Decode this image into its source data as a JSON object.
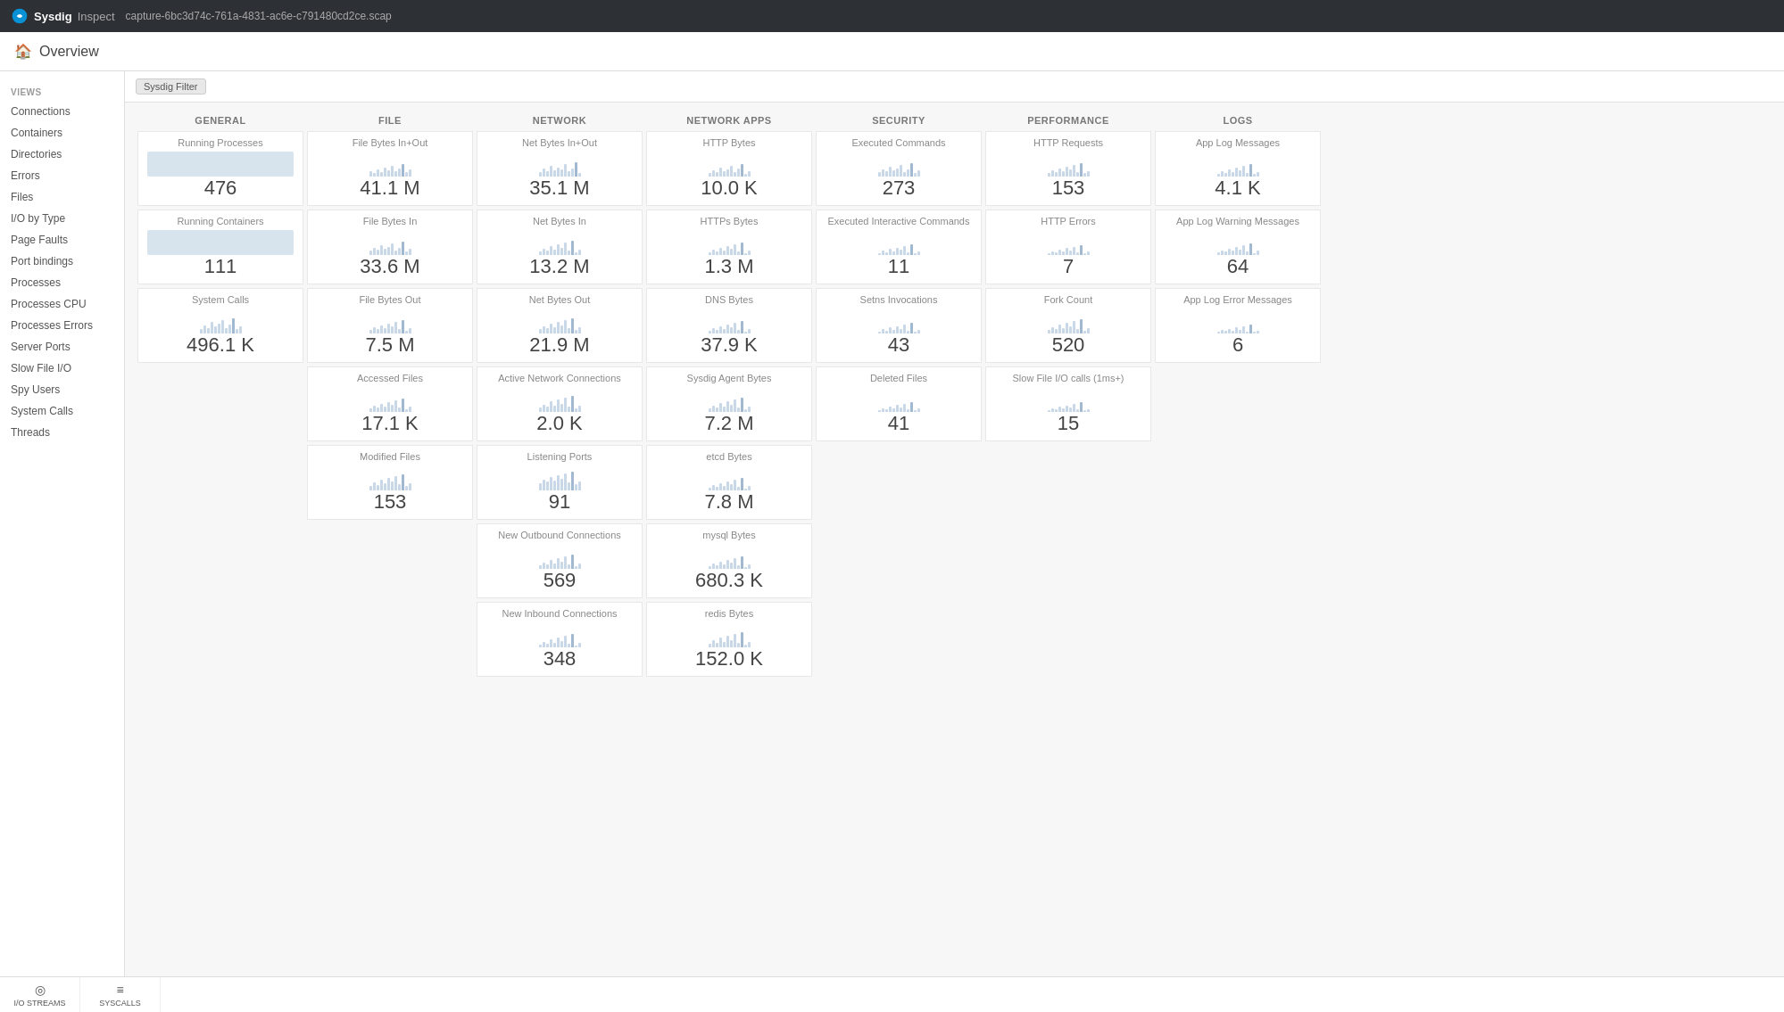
{
  "topbar": {
    "brand": "Sysdig",
    "product": "Inspect",
    "filename": "capture-6bc3d74c-761a-4831-ac6e-c791480cd2ce.scap"
  },
  "subheader": {
    "title": "Overview"
  },
  "filter_label": "Sysdig Filter",
  "sidebar": {
    "section": "VIEWS",
    "items": [
      "Connections",
      "Containers",
      "Directories",
      "Errors",
      "Files",
      "I/O by Type",
      "Page Faults",
      "Port bindings",
      "Processes",
      "Processes CPU",
      "Processes Errors",
      "Server Ports",
      "Slow File I/O",
      "Spy Users",
      "System Calls",
      "Threads"
    ]
  },
  "grid": {
    "columns": [
      "GENERAL",
      "FILE",
      "NETWORK",
      "NETWORK APPS",
      "SECURITY",
      "PERFORMANCE",
      "LOGS"
    ],
    "rows": [
      [
        {
          "label": "Running Processes",
          "value": "476",
          "type": "bg"
        },
        {
          "label": "File Bytes In+Out",
          "value": "41.1 M",
          "type": "bar"
        },
        {
          "label": "Net Bytes In+Out",
          "value": "35.1 M",
          "type": "bar"
        },
        {
          "label": "HTTP Bytes",
          "value": "10.0 K",
          "type": "bar"
        },
        {
          "label": "Executed Commands",
          "value": "273",
          "type": "bar"
        },
        {
          "label": "HTTP Requests",
          "value": "153",
          "type": "bar"
        },
        {
          "label": "App Log Messages",
          "value": "4.1 K",
          "type": "bar"
        }
      ],
      [
        {
          "label": "Running Containers",
          "value": "111",
          "type": "bg"
        },
        {
          "label": "File Bytes In",
          "value": "33.6 M",
          "type": "bar"
        },
        {
          "label": "Net Bytes In",
          "value": "13.2 M",
          "type": "bar"
        },
        {
          "label": "HTTPs Bytes",
          "value": "1.3 M",
          "type": "bar"
        },
        {
          "label": "Executed Interactive Commands",
          "value": "11",
          "type": "bar"
        },
        {
          "label": "HTTP Errors",
          "value": "7",
          "type": "bar"
        },
        {
          "label": "App Log Warning Messages",
          "value": "64",
          "type": "bar"
        }
      ],
      [
        {
          "label": "System Calls",
          "value": "496.1 K",
          "type": "bar"
        },
        {
          "label": "File Bytes Out",
          "value": "7.5 M",
          "type": "bar"
        },
        {
          "label": "Net Bytes Out",
          "value": "21.9 M",
          "type": "bar"
        },
        {
          "label": "DNS Bytes",
          "value": "37.9 K",
          "type": "bar"
        },
        {
          "label": "Setns Invocations",
          "value": "43",
          "type": "bar"
        },
        {
          "label": "Fork Count",
          "value": "520",
          "type": "bar"
        },
        {
          "label": "App Log Error Messages",
          "value": "6",
          "type": "bar"
        }
      ],
      [
        {
          "label": "",
          "value": "",
          "type": "empty"
        },
        {
          "label": "Accessed Files",
          "value": "17.1 K",
          "type": "bar"
        },
        {
          "label": "Active Network Connections",
          "value": "2.0 K",
          "type": "bar"
        },
        {
          "label": "Sysdig Agent Bytes",
          "value": "7.2 M",
          "type": "bar"
        },
        {
          "label": "Deleted Files",
          "value": "41",
          "type": "bar"
        },
        {
          "label": "Slow File I/O calls (1ms+)",
          "value": "15",
          "type": "bar"
        },
        {
          "label": "",
          "value": "",
          "type": "empty"
        }
      ],
      [
        {
          "label": "",
          "value": "",
          "type": "empty"
        },
        {
          "label": "Modified Files",
          "value": "153",
          "type": "bar"
        },
        {
          "label": "Listening Ports",
          "value": "91",
          "type": "bar"
        },
        {
          "label": "etcd Bytes",
          "value": "7.8 M",
          "type": "bar"
        },
        {
          "label": "",
          "value": "",
          "type": "empty"
        },
        {
          "label": "",
          "value": "",
          "type": "empty"
        },
        {
          "label": "",
          "value": "",
          "type": "empty"
        }
      ],
      [
        {
          "label": "",
          "value": "",
          "type": "empty"
        },
        {
          "label": "",
          "value": "",
          "type": "empty"
        },
        {
          "label": "New Outbound Connections",
          "value": "569",
          "type": "bar"
        },
        {
          "label": "mysql Bytes",
          "value": "680.3 K",
          "type": "bar"
        },
        {
          "label": "",
          "value": "",
          "type": "empty"
        },
        {
          "label": "",
          "value": "",
          "type": "empty"
        },
        {
          "label": "",
          "value": "",
          "type": "empty"
        }
      ],
      [
        {
          "label": "",
          "value": "",
          "type": "empty"
        },
        {
          "label": "",
          "value": "",
          "type": "empty"
        },
        {
          "label": "New Inbound Connections",
          "value": "348",
          "type": "bar"
        },
        {
          "label": "redis Bytes",
          "value": "152.0 K",
          "type": "bar"
        },
        {
          "label": "",
          "value": "",
          "type": "empty"
        },
        {
          "label": "",
          "value": "",
          "type": "empty"
        },
        {
          "label": "",
          "value": "",
          "type": "empty"
        }
      ]
    ]
  },
  "bottombar": {
    "buttons": [
      {
        "label": "I/O STREAMS",
        "icon": "◎"
      },
      {
        "label": "SYSCALLS",
        "icon": "≡"
      }
    ]
  }
}
